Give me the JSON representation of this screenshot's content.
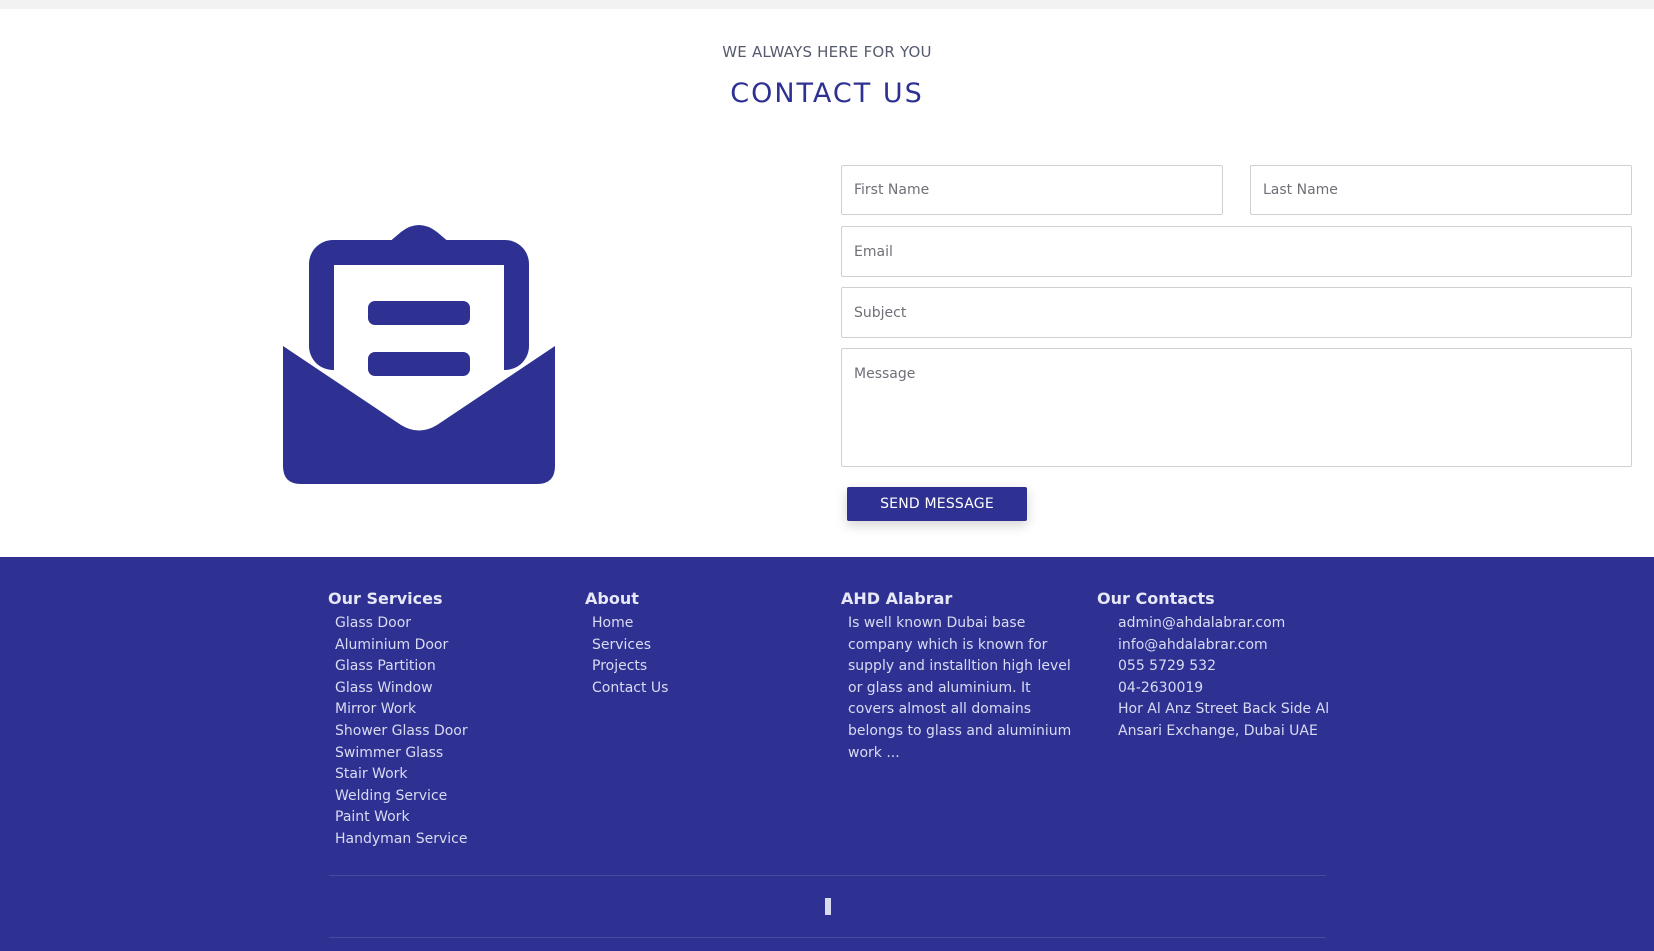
{
  "header": {
    "tagline": "WE ALWAYS HERE FOR YOU",
    "title": "CONTACT US"
  },
  "illustration": {
    "icon": "open-envelope-icon",
    "color": "#2e3192"
  },
  "form": {
    "first_name_placeholder": "First Name",
    "last_name_placeholder": "Last Name",
    "email_placeholder": "Email",
    "subject_placeholder": "Subject",
    "message_placeholder": "Message",
    "submit_label": "SEND MESSAGE"
  },
  "footer": {
    "background": "#2e3192",
    "services": {
      "title": "Our Services",
      "items": [
        "Glass Door",
        "Aluminium Door",
        "Glass Partition",
        "Glass Window",
        "Mirror Work",
        "Shower Glass Door",
        "Swimmer Glass",
        "Stair Work",
        "Welding Service",
        "Paint Work",
        "Handyman Service"
      ]
    },
    "about": {
      "title": "About",
      "items": [
        "Home",
        "Services",
        "Projects",
        "Contact Us"
      ]
    },
    "company": {
      "title": "AHD Alabrar",
      "description": "Is well known Dubai base company which is known for supply and installtion high level or glass and aluminium. It covers almost all domains belongs to glass and aluminium work ..."
    },
    "contacts": {
      "title": "Our Contacts",
      "email_1": "admin@ahdalabrar.com",
      "email_2": "info@ahdalabrar.com",
      "phone_1": "055 5729 532",
      "phone_2": "04-2630019",
      "address_line_1": "Hor Al Anz Street Back Side Al",
      "address_line_2": "Ansari Exchange, Dubai UAE"
    }
  }
}
